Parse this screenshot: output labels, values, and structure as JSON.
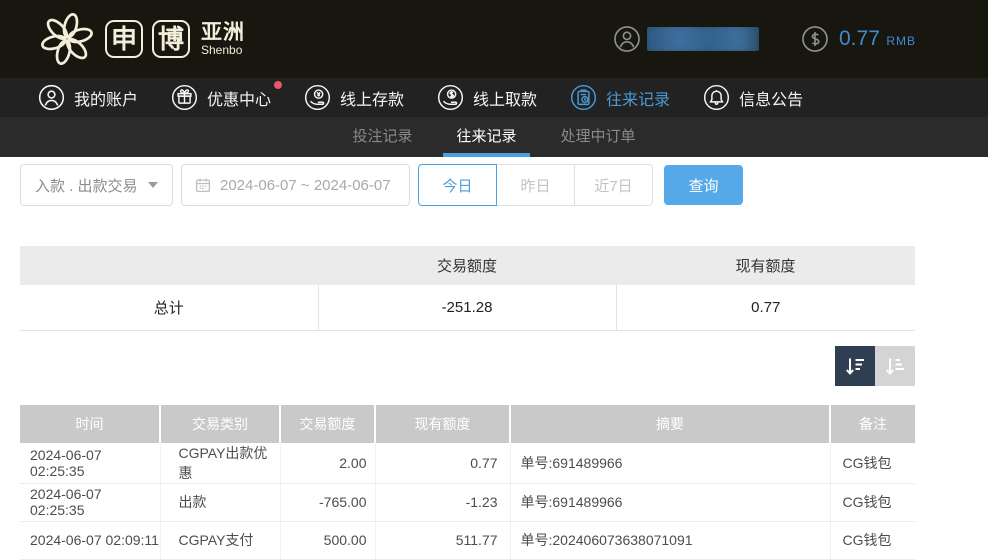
{
  "header": {
    "logo": {
      "box_chars": [
        "申",
        "博"
      ],
      "region": "亚洲",
      "subtitle": "Shenbo"
    },
    "balance": {
      "amount": "0.77",
      "currency": "RMB"
    }
  },
  "nav": {
    "items": [
      {
        "label": "我的账户",
        "icon": "user-icon",
        "active": false
      },
      {
        "label": "优惠中心",
        "icon": "gift-icon",
        "active": false,
        "badge_dot": true
      },
      {
        "label": "线上存款",
        "icon": "deposit-icon",
        "active": false
      },
      {
        "label": "线上取款",
        "icon": "withdraw-icon",
        "active": false
      },
      {
        "label": "往来记录",
        "icon": "records-icon",
        "active": true
      },
      {
        "label": "信息公告",
        "icon": "bell-icon",
        "active": false
      }
    ]
  },
  "tabs": {
    "items": [
      {
        "label": "投注记录",
        "active": false
      },
      {
        "label": "往来记录",
        "active": true
      },
      {
        "label": "处理中订单",
        "active": false
      }
    ]
  },
  "filters": {
    "type_select": {
      "value": "入款 . 出款交易"
    },
    "date_range": {
      "value": "2024-06-07 ~ 2024-06-07"
    },
    "quick_ranges": [
      {
        "label": "今日",
        "active": true
      },
      {
        "label": "昨日",
        "active": false
      },
      {
        "label": "近7日",
        "active": false
      }
    ],
    "query_button": "查询"
  },
  "summary": {
    "columns": [
      "交易额度",
      "现有额度"
    ],
    "row_label": "总计",
    "transaction_total": "-251.28",
    "balance_total": "0.77"
  },
  "records": {
    "columns": [
      "时间",
      "交易类别",
      "交易额度",
      "现有额度",
      "摘要",
      "备注"
    ],
    "rows": [
      {
        "time": "2024-06-07 02:25:35",
        "type": "CGPAY出款优惠",
        "amount": "2.00",
        "balance": "0.77",
        "summary": "单号:691489966",
        "note": "CG钱包"
      },
      {
        "time": "2024-06-07 02:25:35",
        "type": "出款",
        "amount": "-765.00",
        "balance": "-1.23",
        "summary": "单号:691489966",
        "note": "CG钱包"
      },
      {
        "time": "2024-06-07 02:09:11",
        "type": "CGPAY支付",
        "amount": "500.00",
        "balance": "511.77",
        "summary": "单号:202406073638071091",
        "note": "CG钱包"
      }
    ]
  },
  "colors": {
    "accent_blue": "#4aa0e0",
    "balance_blue": "#3f8ad2",
    "query_button_blue": "#55a9e8",
    "badge_red": "#e8566a",
    "topbar_bg": "#17160f",
    "navbar_bg": "#222222",
    "tabbar_bg": "#2b2b2b",
    "table_header_gray": "#c9c9c9",
    "sort_active_bg": "#2f3f51",
    "logo_cream": "#f2eeda"
  }
}
